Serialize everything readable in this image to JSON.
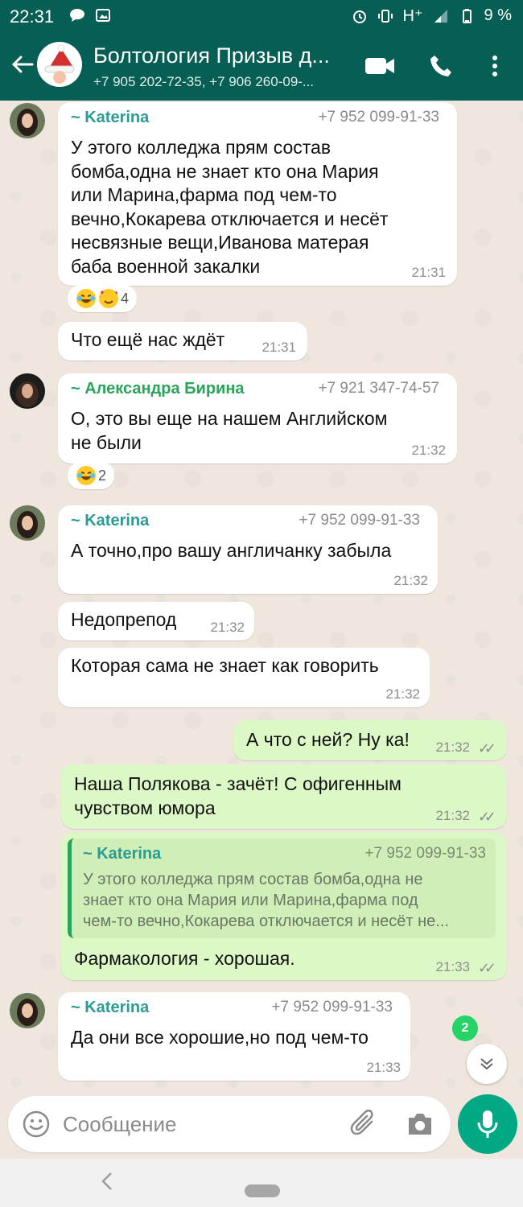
{
  "status_bar": {
    "time": "22:31",
    "network": "H⁺",
    "battery": "9 %"
  },
  "header": {
    "title": "Болтология Призыв д...",
    "subtitle": "+7 905 202-72-35, +7 906 260-09-..."
  },
  "messages": [
    {
      "sender": "~ Katerina",
      "phone": "+7 952 099-91-33",
      "lines": [
        "У этого колледжа прям состав",
        "бомба,одна не знает кто она Мария",
        "или Марина,фарма под чем-то",
        "вечно,Кокарева отключается и несёт",
        "несвязные вещи,Иванова матерая",
        "баба военной закалки"
      ],
      "time": "21:31",
      "reaction_count": "4"
    },
    {
      "lines": [
        "Что ещё нас ждёт"
      ],
      "time": "21:31"
    },
    {
      "sender": "~ Александра Бирина",
      "phone": "+7 921 347-74-57",
      "lines": [
        "О, это вы еще на нашем Английском",
        "не были"
      ],
      "time": "21:32",
      "reaction_count": "2"
    },
    {
      "sender": "~ Katerina",
      "phone": "+7 952 099-91-33",
      "lines": [
        "А точно,про вашу англичанку забыла"
      ],
      "time": "21:32"
    },
    {
      "lines": [
        "Недопрепод"
      ],
      "time": "21:32"
    },
    {
      "lines": [
        "Которая сама не знает как говорить"
      ],
      "time": "21:32"
    },
    {
      "lines": [
        "А что с ней? Ну ка!"
      ],
      "time": "21:32"
    },
    {
      "lines": [
        "Наша Полякова - зачёт! С офигенным",
        "чувством юмора"
      ],
      "time": "21:32"
    },
    {
      "quote": {
        "sender": "~ Katerina",
        "phone": "+7 952 099-91-33",
        "lines": [
          "У этого колледжа прям состав бомба,одна не",
          "знает кто она Мария или Марина,фарма под",
          "чем-то вечно,Кокарева отключается и несёт не..."
        ]
      },
      "lines": [
        "Фармакология - хорошая."
      ],
      "time": "21:33"
    },
    {
      "sender": "~ Katerina",
      "phone": "+7 952 099-91-33",
      "lines": [
        "Да они все хорошие,но под чем-то"
      ],
      "time": "21:33"
    }
  ],
  "unread_count": "2",
  "composer": {
    "placeholder": "Сообщение"
  },
  "icons": [
    "back-arrow-icon",
    "video-call-icon",
    "phone-icon",
    "more-vert-icon",
    "emoji-icon",
    "attach-icon",
    "camera-icon",
    "mic-icon",
    "chevron-down-icon"
  ],
  "colors": {
    "header": "#075e54",
    "outgoing_bubble": "#dcf8c6",
    "accent": "#00a884",
    "sender_teal": "#2a9c93",
    "sender_green": "#27a559"
  }
}
